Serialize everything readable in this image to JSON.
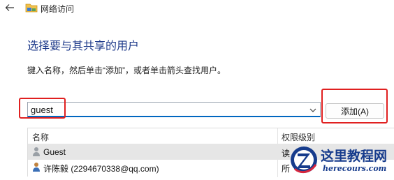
{
  "window": {
    "title": "网络访问"
  },
  "page": {
    "heading": "选择要与其共享的用户",
    "instruction": "键入名称，然后单击“添加”，或者单击箭头查找用户。"
  },
  "name_input": {
    "value": "guest"
  },
  "add_button": {
    "label": "添加(A)"
  },
  "table": {
    "columns": [
      "名称",
      "权限级别"
    ],
    "rows": [
      {
        "name": "Guest",
        "permission": "读",
        "selected": true
      },
      {
        "name": "许陈毅 (2294670338@qq.com)",
        "permission": "所",
        "selected": false
      }
    ]
  },
  "annotations": {
    "highlight_color": "#e02020"
  },
  "watermark": {
    "title": "这里教程网",
    "url": "herecours.com"
  },
  "icons": {
    "back": "arrow-left-icon",
    "folder": "folder-icon",
    "dropdown": "chevron-down-icon",
    "user": "user-icon"
  },
  "colors": {
    "heading": "#1e3a8a",
    "focus_underline": "#0067c0",
    "watermark": "#163b8c"
  }
}
